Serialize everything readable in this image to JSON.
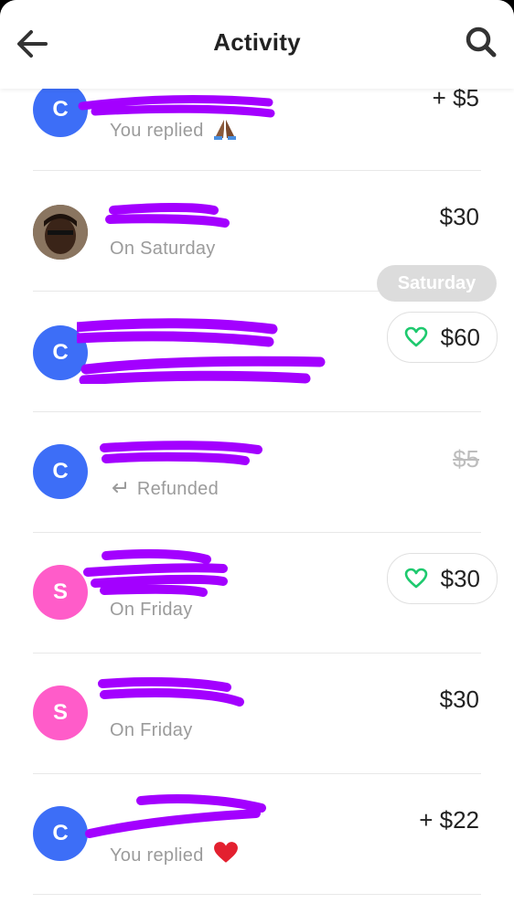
{
  "header": {
    "title": "Activity",
    "back_icon": "back-arrow-icon",
    "search_icon": "search-icon"
  },
  "date_chip": "Saturday",
  "colors": {
    "avatar_blue": "#3d6ef7",
    "avatar_pink": "#ff5cc9",
    "redaction": "#a300ff",
    "heart": "#1ec96e"
  },
  "rows": [
    {
      "avatar_letter": "C",
      "subtitle": "You replied",
      "reaction_icon": "praying-hands-icon",
      "amount": "+ $5"
    },
    {
      "avatar_letter": "",
      "subtitle": "On Saturday",
      "amount": "$30"
    },
    {
      "avatar_letter": "C",
      "subtitle": "",
      "amount": "$60",
      "liked": true
    },
    {
      "avatar_letter": "C",
      "subtitle": "Refunded",
      "amount": "$5",
      "refunded": true
    },
    {
      "avatar_letter": "S",
      "subtitle": "On Friday",
      "amount": "$30",
      "liked": true
    },
    {
      "avatar_letter": "S",
      "subtitle": "On Friday",
      "amount": "$30"
    },
    {
      "avatar_letter": "C",
      "subtitle": "You replied",
      "reaction_icon": "heart-emoji-icon",
      "amount": "+ $22"
    }
  ]
}
